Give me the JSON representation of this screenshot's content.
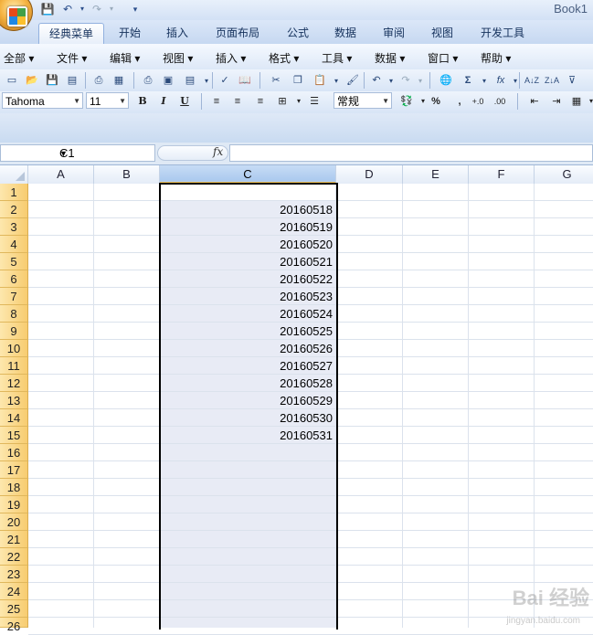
{
  "window": {
    "title": "Book1"
  },
  "ribbon_tabs": [
    {
      "label": "经典菜单",
      "active": true
    },
    {
      "label": "开始"
    },
    {
      "label": "插入"
    },
    {
      "label": "页面布局"
    },
    {
      "label": "公式"
    },
    {
      "label": "数据"
    },
    {
      "label": "审阅"
    },
    {
      "label": "视图"
    },
    {
      "label": "开发工具"
    }
  ],
  "menu": [
    "全部",
    "文件",
    "编辑",
    "视图",
    "插入",
    "格式",
    "工具",
    "数据",
    "窗口",
    "帮助"
  ],
  "format_toolbar": {
    "font": "Tahoma",
    "size": "11",
    "number_format": "常规",
    "bold": "B",
    "italic": "I",
    "underline": "U",
    "percent": "%",
    "comma": ","
  },
  "formula_bar": {
    "name_box": "C1",
    "fx": "fx",
    "formula": ""
  },
  "columns": [
    "A",
    "B",
    "C",
    "D",
    "E",
    "F",
    "G"
  ],
  "selected_column": "C",
  "rows": [
    "1",
    "2",
    "3",
    "4",
    "5",
    "6",
    "7",
    "8",
    "9",
    "10",
    "11",
    "12",
    "13",
    "14",
    "15",
    "16",
    "17",
    "18",
    "19",
    "20",
    "21",
    "22",
    "23",
    "24",
    "25",
    "26"
  ],
  "cells_c": [
    "",
    "20160518",
    "20160519",
    "20160520",
    "20160521",
    "20160522",
    "20160523",
    "20160524",
    "20160525",
    "20160526",
    "20160527",
    "20160528",
    "20160529",
    "20160530",
    "20160531"
  ],
  "watermark": {
    "text": "Bai 经验",
    "sub": "jingyan.baidu.com"
  },
  "colors": {
    "selection_fill": "#e8ebf5",
    "row_header": "#fbd479",
    "accent": "#2b579a"
  }
}
